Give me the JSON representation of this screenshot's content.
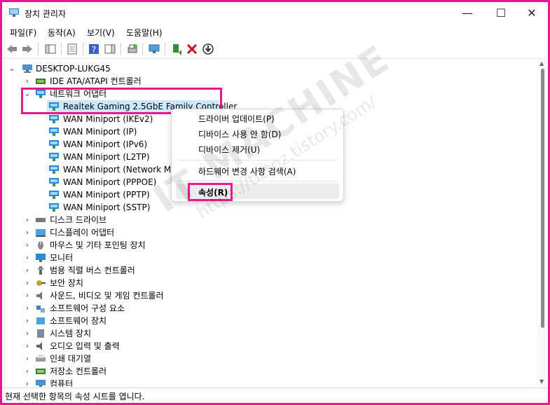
{
  "window": {
    "title": "장치 관리자",
    "minimize": "—",
    "maximize": "☐",
    "close": "✕"
  },
  "menu": [
    "파일(F)",
    "동작(A)",
    "보기(V)",
    "도움말(H)"
  ],
  "tree": {
    "root": "DESKTOP-LUKG45",
    "ide": "IDE ATA/ATAPI 컨트롤러",
    "network": "네트워크 어댑터",
    "adapters": [
      "Realtek Gaming 2.5GbE Family Controller",
      "WAN Miniport (IKEv2)",
      "WAN Miniport (IP)",
      "WAN Miniport (IPv6)",
      "WAN Miniport (L2TP)",
      "WAN Miniport (Network Mo",
      "WAN Miniport (PPPOE)",
      "WAN Miniport (PPTP)",
      "WAN Miniport (SSTP)"
    ],
    "categories": [
      "디스크 드라이브",
      "디스플레이 어댑터",
      "마우스 및 기타 포인팅 장치",
      "모니터",
      "범용 직렬 버스 컨트롤러",
      "보안 장치",
      "사운드, 비디오 및 게임 컨트롤러",
      "소프트웨어 구성 요소",
      "소프트웨어 장치",
      "시스템 장치",
      "오디오 입력 및 출력",
      "인쇄 대기열",
      "저장소 컨트롤러",
      "컴퓨터"
    ]
  },
  "context_menu": {
    "update_driver": "드라이버 업데이트(P)",
    "disable": "디바이스 사용 안 함(D)",
    "uninstall": "디바이스 제거(U)",
    "scan": "하드웨어 변경 사항 검색(A)",
    "properties": "속성(R)"
  },
  "status": "현재 선택한 항목의 속성 시트를 엽니다.",
  "watermark": {
    "line1": "IT MACHINE",
    "line2": "https://tiztoz.tistory.com/"
  },
  "colors": {
    "highlight_border": "#e8198a",
    "selection": "#cce8ff",
    "network_icon": "#2a8ad4"
  }
}
